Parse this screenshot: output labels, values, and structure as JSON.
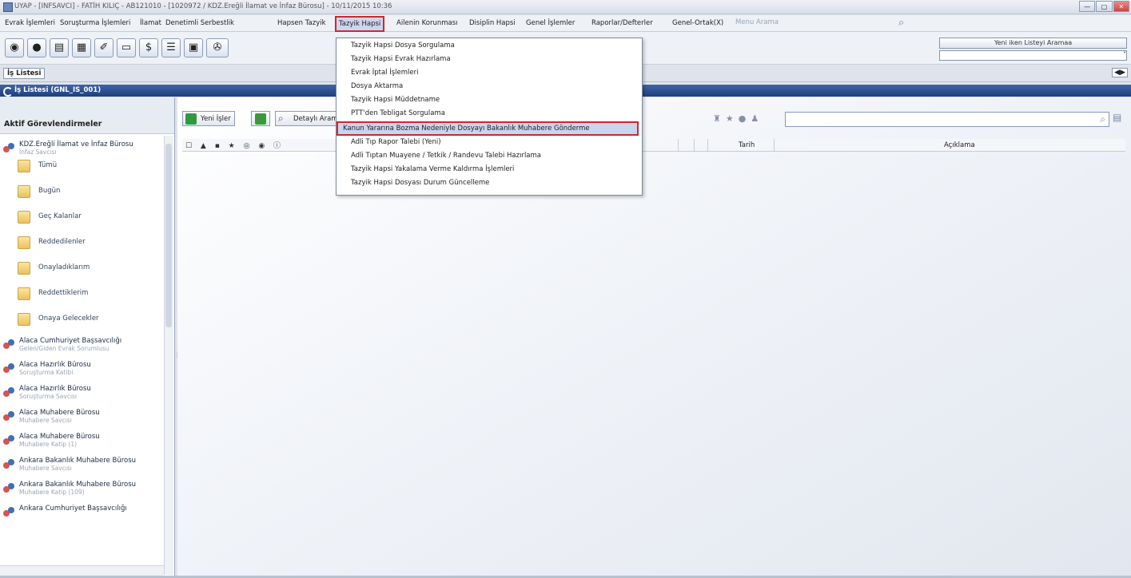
{
  "window": {
    "title": "UYAP - [INFSAVCI] - FATİH KILIÇ - AB121010 - [1020972 / KDZ.Ereğli İlamat ve İnfaz Bürosu] - 10/11/2015 10:36",
    "buttons": [
      "—",
      "▢",
      "✕"
    ]
  },
  "menubar": {
    "items": [
      "Evrak İşlemleri",
      "Soruşturma İşlemleri",
      "İlamat",
      "Denetimli Serbestlik",
      "Hapsen Tazyik",
      "Tazyik Hapsi",
      "Ailenin Korunması",
      "Disiplin Hapsi",
      "Genel İşlemler",
      "Raporlar/Defterler",
      "Genel-Ortak(X)"
    ],
    "selected": "Tazyik Hapsi",
    "search_placeholder": "Menu Arama"
  },
  "toolbar": {
    "icons": [
      "disc-icon",
      "record-icon",
      "image-icon",
      "grid-icon",
      "tag-icon",
      "note-icon",
      "dollar-icon",
      "list-icon",
      "window-icon",
      "puzzle-icon"
    ],
    "right_select_label": "Yeni iken Listeyi Aramaa",
    "right_select2_value": "˅"
  },
  "tabs": {
    "active": "İş Listesi",
    "nav": "◀▶"
  },
  "panel_title": "İş Listesi (GNL_IS_001)",
  "left_panel": {
    "header": "Aktif Görevlendirmeler",
    "first_group": {
      "name": "KDZ.Ereğli İlamat ve İnfaz Bürosu",
      "sub": "İnfaz Savcısı"
    },
    "folders": [
      "Tümü",
      "Bugün",
      "Geç Kalanlar",
      "Reddedilenler",
      "Onayladıklarım",
      "Reddettiklerim",
      "Onaya Gelecekler"
    ],
    "groups": [
      {
        "name": "Alaca Cumhuriyet Başsavcılığı",
        "sub": "Gelen/Giden Evrak Sorumlusu"
      },
      {
        "name": "Alaca Hazırlık Bürosu",
        "sub": "Soruşturma Katibi"
      },
      {
        "name": "Alaca Hazırlık Bürosu",
        "sub": "Soruşturma Savcısı"
      },
      {
        "name": "Alaca Muhabere Bürosu",
        "sub": "Muhabere Savcısı"
      },
      {
        "name": "Alaca Muhabere Bürosu",
        "sub": "Muhabere Katip (1)"
      },
      {
        "name": "Ankara Bakanlık Muhabere Bürosu",
        "sub": "Muhabere Savcısı"
      },
      {
        "name": "Ankara Bakanlık Muhabere Bürosu",
        "sub": "Muhabere Katip (109)"
      },
      {
        "name": "Ankara Cumhuriyet Başsavcılığı",
        "sub": ""
      }
    ]
  },
  "main": {
    "buttons": {
      "new_jobs": "Yeni İşler",
      "details": "Detaylı Arama"
    },
    "columns": {
      "date": "Tarih",
      "description": "Açıklama"
    },
    "header_icons": "☐ ▲ ▪ ★ ◎ ◉ ⓘ"
  },
  "dropdown": {
    "items": [
      "Tazyik Hapsi Dosya Sorgulama",
      "Tazyik Hapsi Evrak Hazırlama",
      "Evrak İptal İşlemleri",
      "Dosya Aktarma",
      "Tazyik Hapsi Müddetname",
      "PTT'den Tebligat Sorgulama",
      "Kanun Yararına Bozma Nedeniyle Dosyayı Bakanlık Muhabere Gönderme",
      "Adli Tıp Rapor Talebi (Yeni)",
      "Adli Tıptan Muayene / Tetkik / Randevu Talebi Hazırlama",
      "Tazyik Hapsi Yakalama Verme Kaldırma İşlemleri",
      "Tazyik Hapsi Dosyası Durum Güncelleme"
    ],
    "highlighted_index": 6
  },
  "colors": {
    "highlight_border": "#d2262c",
    "panel_header": "#2b4d8f"
  }
}
